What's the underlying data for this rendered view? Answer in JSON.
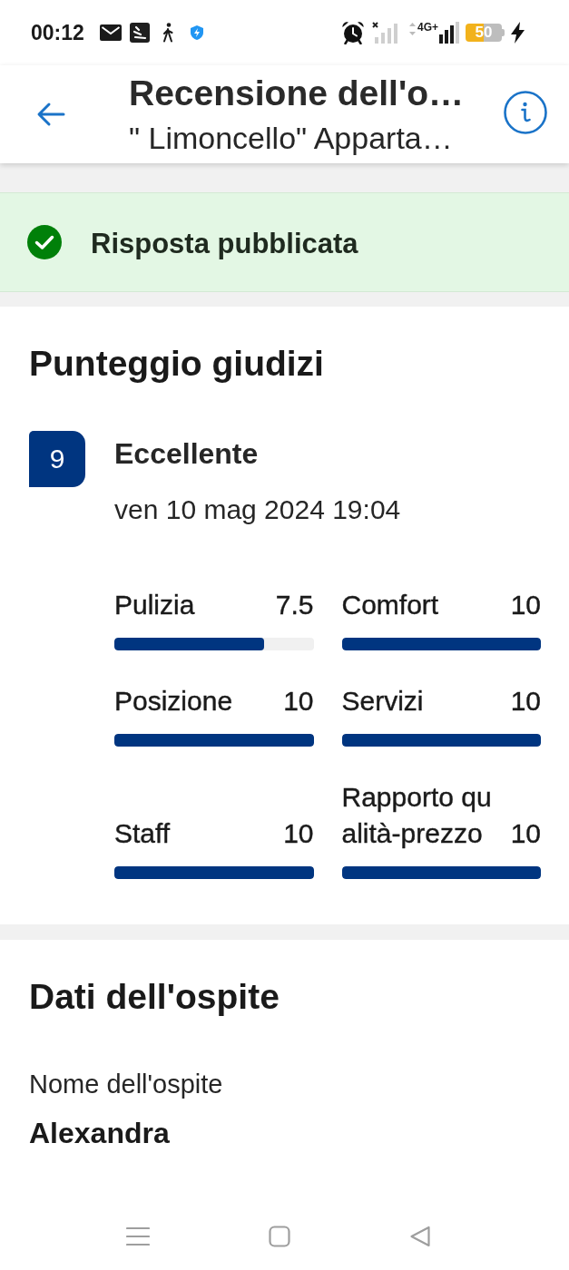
{
  "status_bar": {
    "time": "00:12",
    "network": "4G+",
    "battery": "50"
  },
  "header": {
    "title": "Recensione dell'o…",
    "subtitle": "\" Limoncello\" Apparta…"
  },
  "banner": {
    "kind": "success",
    "text": "Risposta pubblicata"
  },
  "ratings": {
    "title": "Punteggio giudizi",
    "score": "9",
    "verdict": "Eccellente",
    "date": "ven 10 mag 2024 19:04",
    "categories": [
      {
        "label": "Pulizia",
        "value": "7.5",
        "level": 0.75
      },
      {
        "label": "Posizione",
        "value": "10",
        "level": 1
      },
      {
        "label": "Staff",
        "value": "10",
        "level": 1
      },
      {
        "label": "Comfort",
        "value": "10",
        "level": 1
      },
      {
        "label": "Servizi",
        "value": "10",
        "level": 1
      },
      {
        "label": "Rapporto qualità-prezzo",
        "value": "10",
        "level": 1
      }
    ]
  },
  "guest": {
    "title": "Dati dell'ospite",
    "field_label": "Nome dell'ospite",
    "name": "Alexandra"
  }
}
